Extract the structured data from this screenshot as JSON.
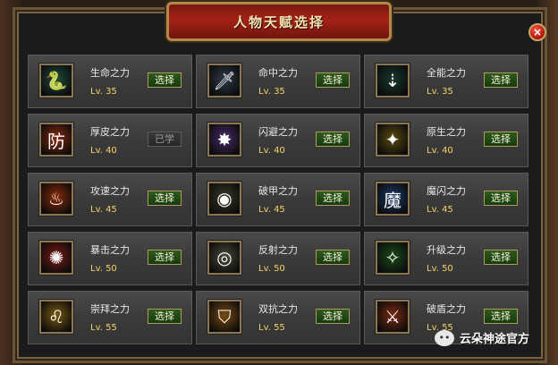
{
  "window": {
    "title": "人物天赋选择",
    "close_glyph": "×"
  },
  "talents": [
    {
      "name": "生命之力",
      "level": "Lv. 35",
      "button": "选择",
      "learned": false,
      "icon": "serpent-icon",
      "glyph": "🐍",
      "color": "#1f4a3a"
    },
    {
      "name": "命中之力",
      "level": "Lv. 35",
      "button": "选择",
      "learned": false,
      "icon": "sword-icon",
      "glyph": "🗡",
      "color": "#2e3a4a"
    },
    {
      "name": "全能之力",
      "level": "Lv. 35",
      "button": "选择",
      "learned": false,
      "icon": "arrows-down-icon",
      "glyph": "⇣",
      "color": "#17372e"
    },
    {
      "name": "厚皮之力",
      "level": "Lv. 40",
      "button": "已学",
      "learned": true,
      "icon": "defense-rune-icon",
      "glyph": "防",
      "color": "#8a2a10"
    },
    {
      "name": "闪避之力",
      "level": "Lv. 40",
      "button": "选择",
      "learned": false,
      "icon": "dodge-burst-icon",
      "glyph": "✸",
      "color": "#4a2a6a"
    },
    {
      "name": "原生之力",
      "level": "Lv. 40",
      "button": "选择",
      "learned": false,
      "icon": "golden-beast-icon",
      "glyph": "✦",
      "color": "#5a4a10"
    },
    {
      "name": "攻速之力",
      "level": "Lv. 45",
      "button": "选择",
      "learned": false,
      "icon": "fire-spikes-icon",
      "glyph": "♨",
      "color": "#8a2a08"
    },
    {
      "name": "破甲之力",
      "level": "Lv. 45",
      "button": "选择",
      "learned": false,
      "icon": "armor-break-icon",
      "glyph": "◉",
      "color": "#3a3a2a"
    },
    {
      "name": "魔闪之力",
      "level": "Lv. 45",
      "button": "选择",
      "learned": false,
      "icon": "magic-rune-icon",
      "glyph": "魔",
      "color": "#1a3a6a"
    },
    {
      "name": "暴击之力",
      "level": "Lv. 50",
      "button": "选择",
      "learned": false,
      "icon": "critical-swirl-icon",
      "glyph": "✺",
      "color": "#7a1a14"
    },
    {
      "name": "反射之力",
      "level": "Lv. 50",
      "button": "选择",
      "learned": false,
      "icon": "reflect-ring-icon",
      "glyph": "◎",
      "color": "#4a4a3a"
    },
    {
      "name": "升级之力",
      "level": "Lv. 50",
      "button": "选择",
      "learned": false,
      "icon": "green-star-icon",
      "glyph": "✧",
      "color": "#1a4a1a"
    },
    {
      "name": "崇拜之力",
      "level": "Lv. 55",
      "button": "选择",
      "learned": false,
      "icon": "lion-head-icon",
      "glyph": "♌",
      "color": "#7a5a10"
    },
    {
      "name": "双抗之力",
      "level": "Lv. 55",
      "button": "选择",
      "learned": false,
      "icon": "shield-crest-icon",
      "glyph": "⛉",
      "color": "#7a4a10"
    },
    {
      "name": "破盾之力",
      "level": "Lv. 55",
      "button": "选择",
      "learned": false,
      "icon": "sword-break-icon",
      "glyph": "⚔",
      "color": "#7a2a10"
    }
  ],
  "watermark": {
    "text": "云朵神途官方",
    "icon": "wechat-icon",
    "glyph": "••"
  }
}
